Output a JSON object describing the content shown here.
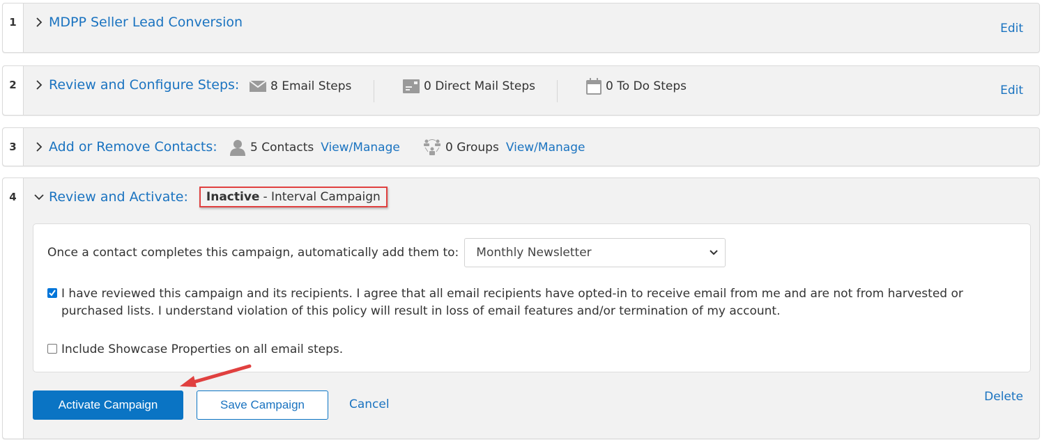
{
  "accent_color": "#1a73c0",
  "primary_button_color": "#0a74c4",
  "highlight_color": "#e0403f",
  "steps": [
    {
      "number": "1",
      "title": "MDPP Seller Lead Conversion",
      "expanded": false,
      "edit_label": "Edit"
    },
    {
      "number": "2",
      "title": "Review and Configure Steps:",
      "expanded": false,
      "edit_label": "Edit",
      "summary": [
        {
          "icon": "envelope-icon",
          "text": "8 Email Steps"
        },
        {
          "icon": "direct-mail-icon",
          "text": "0 Direct Mail Steps"
        },
        {
          "icon": "calendar-icon",
          "text": "0 To Do Steps"
        }
      ]
    },
    {
      "number": "3",
      "title": "Add or Remove Contacts:",
      "expanded": false,
      "contacts": {
        "icon": "person-icon",
        "text": "5 Contacts",
        "link": "View/Manage"
      },
      "groups": {
        "icon": "group-icon",
        "text": "0 Groups",
        "link": "View/Manage"
      }
    },
    {
      "number": "4",
      "title": "Review and Activate:",
      "expanded": true,
      "status_bold": "Inactive",
      "status_rest": "- Interval Campaign",
      "completion_label": "Once a contact completes this campaign, automatically add them to:",
      "completion_select_value": "Monthly Newsletter",
      "agreement_checked": true,
      "agreement_text": "I have reviewed this campaign and its recipients. I agree that all email recipients have opted-in to receive email from me and are not from harvested or purchased lists. I understand violation of this policy will result in loss of email features and/or termination of my account.",
      "showcase_checked": false,
      "showcase_text": "Include Showcase Properties on all email steps.",
      "activate_label": "Activate Campaign",
      "save_label": "Save Campaign",
      "cancel_label": "Cancel",
      "delete_label": "Delete"
    }
  ]
}
